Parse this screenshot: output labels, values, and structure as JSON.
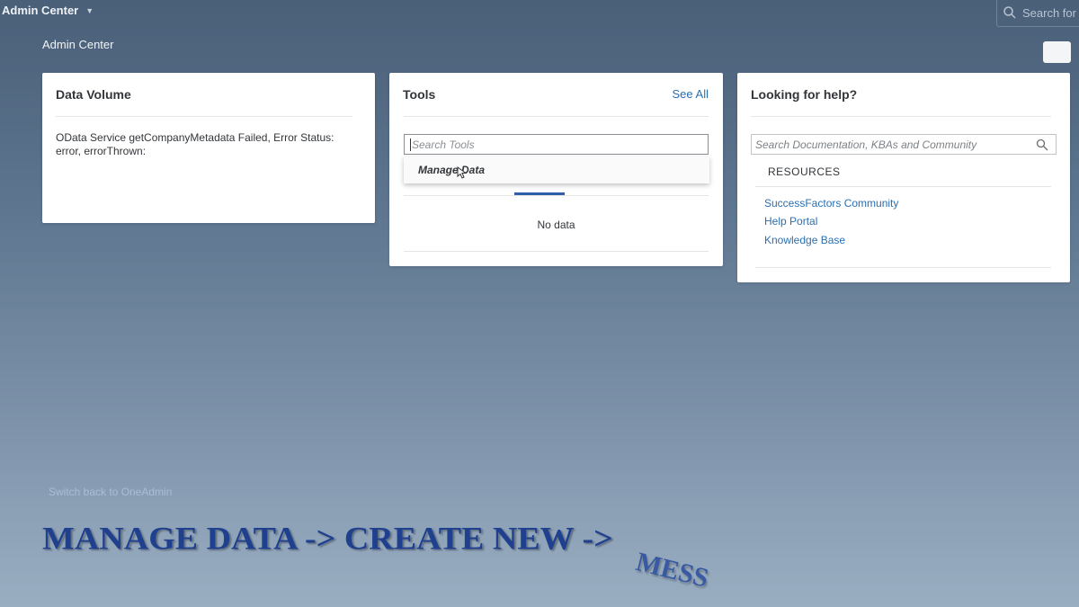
{
  "shell": {
    "app_title": "Admin Center",
    "search_placeholder": "Search for"
  },
  "page": {
    "heading": "Admin Center",
    "switch_link": "Switch back to OneAdmin"
  },
  "data_volume": {
    "title": "Data Volume",
    "message": "OData Service getCompanyMetadata Failed, Error Status: error, errorThrown:"
  },
  "tools": {
    "title": "Tools",
    "see_all": "See All",
    "search_placeholder": "Search Tools",
    "suggestion": "Manage Data",
    "empty_text": "No data"
  },
  "help": {
    "title": "Looking for help?",
    "search_placeholder": "Search Documentation, KBAs and Community",
    "resources_heading": "RESOURCES",
    "links": [
      "SuccessFactors Community",
      "Help Portal",
      "Knowledge Base"
    ]
  },
  "overlay": {
    "caption": "MANAGE DATA -> CREATE NEW ->",
    "caption_tail": "MESS"
  },
  "colors": {
    "link": "#2b6fb0",
    "caption": "#1f3f8f",
    "busy_indicator": "#2e5fa8"
  },
  "icons": [
    "chevron-down-icon",
    "search-icon",
    "mouse-pointer-icon"
  ]
}
